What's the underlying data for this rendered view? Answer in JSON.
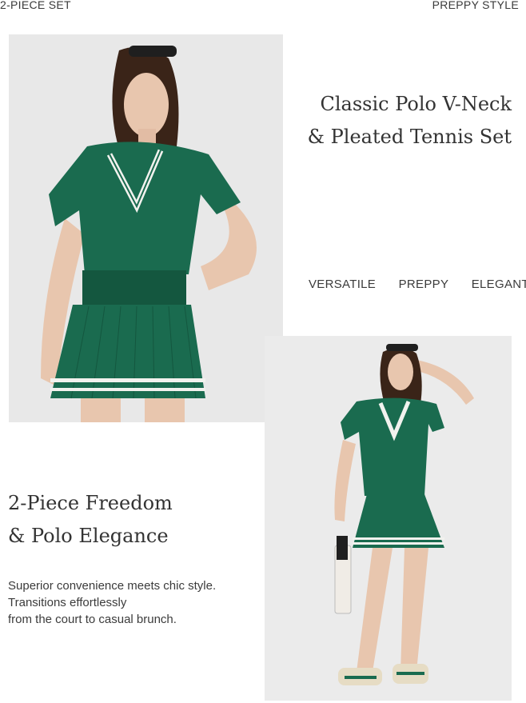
{
  "header": {
    "left_label": "2-PIECE SET",
    "right_label": "PREPPY STYLE"
  },
  "title_block": {
    "line1": "Classic Polo V-Neck",
    "line2": "& Pleated Tennis Set"
  },
  "tags": [
    "VERSATILE",
    "PREPPY",
    "ELEGANT"
  ],
  "subtitle_block": {
    "line1": "2-Piece Freedom",
    "line2": "& Polo Elegance"
  },
  "description": {
    "line1": "Superior convenience meets chic style.",
    "line2": "Transitions effortlessly",
    "line3": "from the court to casual brunch."
  },
  "colors": {
    "outfit_green": "#1a6b4f",
    "stripe_white": "#f2f2ee",
    "skin": "#e8c6ae",
    "hair": "#3a2418",
    "background_gray": "#e9e9e9"
  }
}
